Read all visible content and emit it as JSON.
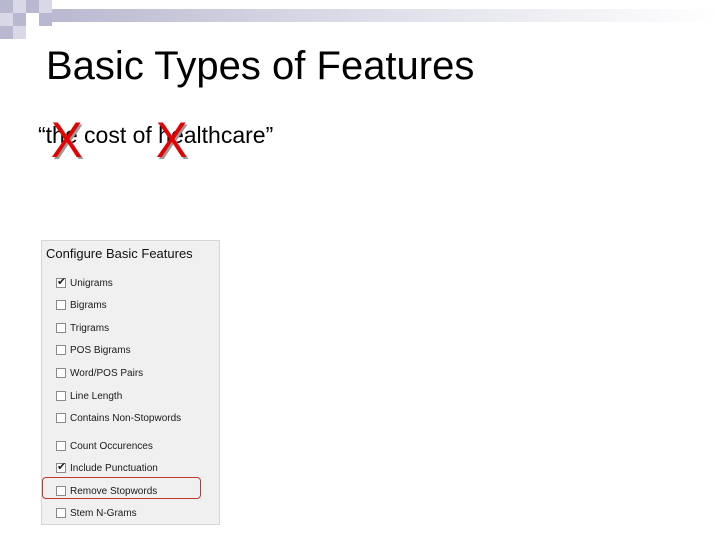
{
  "slide": {
    "title": "Basic Types of Features",
    "phrase": "“the cost of healthcare”",
    "strike_mark": "X",
    "strike_color": "#e60000"
  },
  "panel": {
    "title": "Configure Basic Features",
    "options": [
      {
        "label": "Unigrams",
        "checked": true
      },
      {
        "label": "Bigrams",
        "checked": false
      },
      {
        "label": "Trigrams",
        "checked": false
      },
      {
        "label": "POS Bigrams",
        "checked": false
      },
      {
        "label": "Word/POS Pairs",
        "checked": false
      },
      {
        "label": "Line Length",
        "checked": false
      },
      {
        "label": "Contains Non-Stopwords",
        "checked": false
      },
      {
        "label": "Count Occurences",
        "checked": false
      },
      {
        "label": "Include Punctuation",
        "checked": true
      },
      {
        "label": "Remove Stopwords",
        "checked": false,
        "highlighted": true
      },
      {
        "label": "Stem N-Grams",
        "checked": false
      }
    ],
    "highlight_color": "#c0392b"
  },
  "decor": {
    "accent_dark": "#b8b8d0",
    "accent_light": "#d8d8e6"
  }
}
